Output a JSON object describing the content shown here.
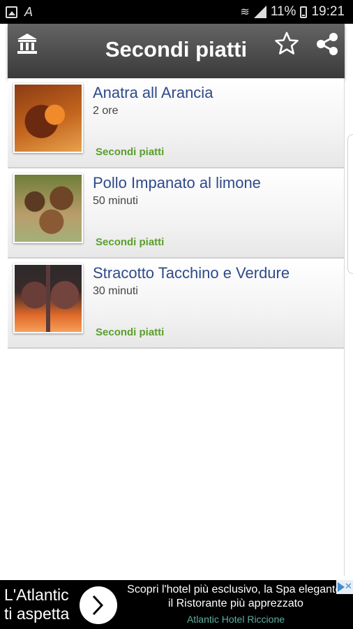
{
  "status_bar": {
    "battery": "11%",
    "time": "19:21",
    "icons": [
      "gallery-icon",
      "font-icon",
      "wifi-icon",
      "signal-icon",
      "battery-icon"
    ]
  },
  "toolbar": {
    "title": "Secondi piatti",
    "icons": [
      "home-icon",
      "star-icon",
      "share-icon"
    ]
  },
  "recipes": [
    {
      "title": "Anatra all Arancia",
      "time": "2 ore",
      "category": "Secondi piatti"
    },
    {
      "title": "Pollo Impanato al limone",
      "time": "50 minuti",
      "category": "Secondi piatti"
    },
    {
      "title": "Stracotto Tacchino e Verdure",
      "time": "30 minuti",
      "category": "Secondi piatti"
    }
  ],
  "ad": {
    "brand_line1": "L'Atlantic",
    "brand_line2": "ti aspetta",
    "text": "Scopri l'hotel più esclusivo, la Spa elegante, il Ristorante più apprezzato",
    "advertiser": "Atlantic Hotel Riccione"
  },
  "colors": {
    "toolbar": "#4a4a4a",
    "recipe_title": "#2f4a8a",
    "category": "#5a9e2c",
    "ad_background": "#000000",
    "ad_advertiser": "#5db0a0"
  }
}
